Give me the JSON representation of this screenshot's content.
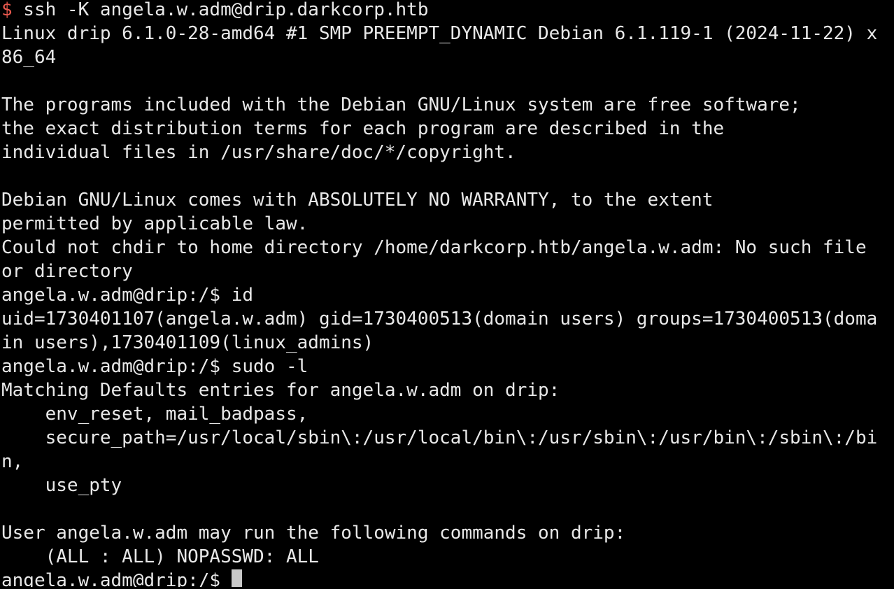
{
  "terminal": {
    "cursor_prompt": "angela.w.adm@drip:/$ ",
    "prompt_symbol": "$",
    "first_command": " ssh -K angela.w.adm@drip.darkcorp.htb",
    "colors": {
      "background": "#000000",
      "text": "#e8e8e8",
      "prompt_symbol": "#e8584d",
      "cursor": "#c8c8c8"
    },
    "lines": [
      "Linux drip 6.1.0-28-amd64 #1 SMP PREEMPT_DYNAMIC Debian 6.1.119-1 (2024-11-22) x",
      "86_64",
      "",
      "The programs included with the Debian GNU/Linux system are free software;",
      "the exact distribution terms for each program are described in the",
      "individual files in /usr/share/doc/*/copyright.",
      "",
      "Debian GNU/Linux comes with ABSOLUTELY NO WARRANTY, to the extent",
      "permitted by applicable law.",
      "Could not chdir to home directory /home/darkcorp.htb/angela.w.adm: No such file",
      "or directory",
      "angela.w.adm@drip:/$ id",
      "uid=1730401107(angela.w.adm) gid=1730400513(domain users) groups=1730400513(doma",
      "in users),1730401109(linux_admins)",
      "angela.w.adm@drip:/$ sudo -l",
      "Matching Defaults entries for angela.w.adm on drip:",
      "    env_reset, mail_badpass,",
      "    secure_path=/usr/local/sbin\\:/usr/local/bin\\:/usr/sbin\\:/usr/bin\\:/sbin\\:/bi",
      "n,",
      "    use_pty",
      "",
      "User angela.w.adm may run the following commands on drip:",
      "    (ALL : ALL) NOPASSWD: ALL"
    ]
  }
}
